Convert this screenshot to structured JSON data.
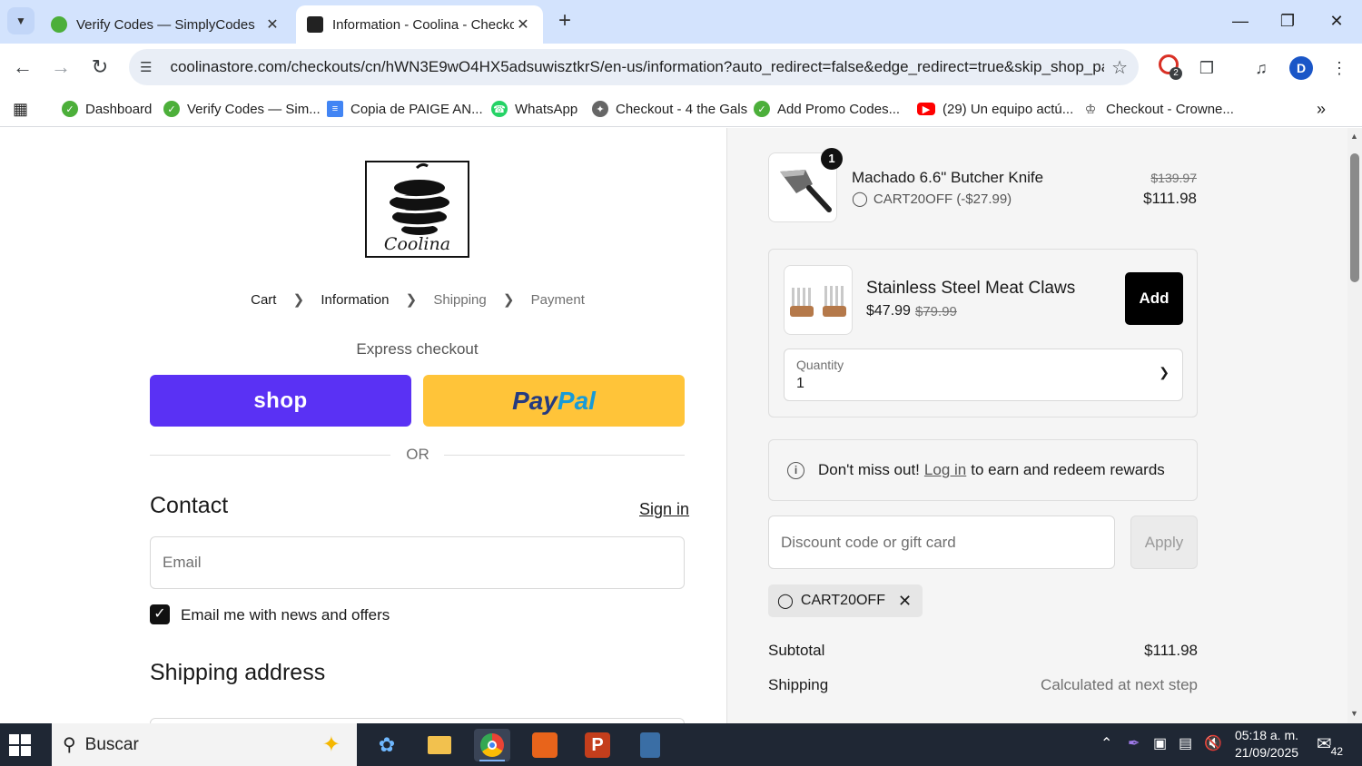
{
  "browser": {
    "tabs": [
      {
        "title": "Verify Codes — SimplyCodes",
        "active": false
      },
      {
        "title": "Information - Coolina - Checkout",
        "active": true
      }
    ],
    "url": "coolinastore.com/checkouts/cn/hWN3E9wO4HX5adsuwisztkrS/en-us/information?auto_redirect=false&edge_redirect=true&skip_shop_pay...",
    "profile_initial": "D",
    "extension_badge": "2",
    "bookmarks": [
      {
        "label": "Dashboard"
      },
      {
        "label": "Verify Codes — Sim..."
      },
      {
        "label": "Copia de PAIGE AN..."
      },
      {
        "label": "WhatsApp"
      },
      {
        "label": "Checkout - 4 the Gals"
      },
      {
        "label": "Add Promo Codes..."
      },
      {
        "label": "(29) Un equipo actú..."
      },
      {
        "label": "Checkout - Crowne..."
      }
    ]
  },
  "store": {
    "logo_text": "Coolina"
  },
  "breadcrumb": {
    "cart": "Cart",
    "information": "Information",
    "shipping": "Shipping",
    "payment": "Payment"
  },
  "express": {
    "title": "Express checkout",
    "shop_label": "shop",
    "paypal_a": "Pay",
    "paypal_b": "Pal",
    "or": "OR"
  },
  "contact": {
    "heading": "Contact",
    "sign_in": "Sign in",
    "email_placeholder": "Email",
    "news_label": "Email me with news and offers",
    "news_checked": true
  },
  "shipping_address": {
    "heading": "Shipping address"
  },
  "order": {
    "item": {
      "quantity": "1",
      "name": "Machado 6.6\" Butcher Knife",
      "discount": "CART20OFF (-$27.99)",
      "original_price": "$139.97",
      "price": "$111.98"
    },
    "upsell": {
      "name": "Stainless Steel Meat Claws",
      "price": "$47.99",
      "compare_price": "$79.99",
      "add_label": "Add",
      "quantity_label": "Quantity",
      "quantity_value": "1"
    },
    "rewards": {
      "before": "Don't miss out!",
      "link": "Log in",
      "after": "to earn and redeem rewards"
    },
    "discount": {
      "placeholder": "Discount code or gift card",
      "apply_label": "Apply",
      "applied_code": "CART20OFF"
    },
    "summary": {
      "subtotal_label": "Subtotal",
      "subtotal_value": "$111.98",
      "shipping_label": "Shipping",
      "shipping_value": "Calculated at next step"
    }
  },
  "taskbar": {
    "search_placeholder": "Buscar",
    "time": "05:18 a. m.",
    "date": "21/09/2025",
    "notifications": "42"
  },
  "colors": {
    "shop_pay": "#5a31f4",
    "paypal": "#ffc439",
    "tabbar": "#d3e3fd"
  }
}
